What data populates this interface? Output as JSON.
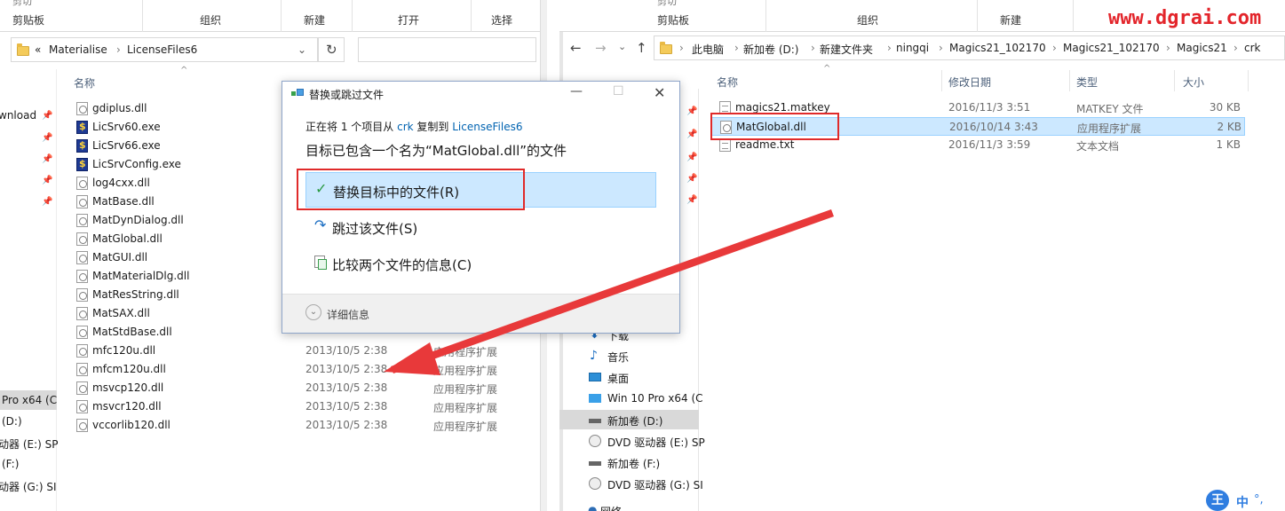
{
  "left": {
    "ribbon": {
      "cut": "剪贴板",
      "clipboard": "剪贴板",
      "organize": "组织",
      "new": "新建",
      "open": "打开",
      "select": "选择"
    },
    "path": [
      "Materialise",
      "LicenseFiles6"
    ],
    "back": "«",
    "columns": {
      "name": "名称"
    },
    "files": [
      {
        "name": "gdiplus.dll",
        "icon": "dll"
      },
      {
        "name": "LicSrv60.exe",
        "icon": "exe"
      },
      {
        "name": "LicSrv66.exe",
        "icon": "exe"
      },
      {
        "name": "LicSrvConfig.exe",
        "icon": "exe"
      },
      {
        "name": "log4cxx.dll",
        "icon": "dll"
      },
      {
        "name": "MatBase.dll",
        "icon": "dll"
      },
      {
        "name": "MatDynDialog.dll",
        "icon": "dll"
      },
      {
        "name": "MatGlobal.dll",
        "icon": "dll"
      },
      {
        "name": "MatGUI.dll",
        "icon": "dll"
      },
      {
        "name": "MatMaterialDlg.dll",
        "icon": "dll"
      },
      {
        "name": "MatResString.dll",
        "icon": "dll"
      },
      {
        "name": "MatSAX.dll",
        "icon": "dll"
      },
      {
        "name": "MatStdBase.dll",
        "icon": "dll"
      },
      {
        "name": "mfc120u.dll",
        "icon": "dll",
        "date": "2013/10/5 2:38",
        "type": "应用程序扩展"
      },
      {
        "name": "mfcm120u.dll",
        "icon": "dll",
        "date": "2013/10/5 2:38",
        "type": "应用程序扩展"
      },
      {
        "name": "msvcp120.dll",
        "icon": "dll",
        "date": "2013/10/5 2:38",
        "type": "应用程序扩展"
      },
      {
        "name": "msvcr120.dll",
        "icon": "dll",
        "date": "2013/10/5 2:38",
        "type": "应用程序扩展"
      },
      {
        "name": "vccorlib120.dll",
        "icon": "dll",
        "date": "2013/10/5 2:38",
        "type": "应用程序扩展"
      }
    ],
    "nav": [
      {
        "label": "wnload"
      },
      {
        "label": "Pro x64 (C"
      },
      {
        "label": "(D:)"
      },
      {
        "label": "动器 (E:) SP"
      },
      {
        "label": "(F:)"
      },
      {
        "label": "动器 (G:) SI"
      }
    ]
  },
  "right": {
    "ribbon": {
      "clipboard": "剪贴板",
      "organize": "组织",
      "new": "新建"
    },
    "watermark": "www.dgrai.com",
    "path": [
      "此电脑",
      "新加卷 (D:)",
      "新建文件夹",
      "ningqi",
      "Magics21_102170",
      "Magics21_102170",
      "Magics21",
      "crk"
    ],
    "columns": {
      "name": "名称",
      "date": "修改日期",
      "type": "类型",
      "size": "大小"
    },
    "files": [
      {
        "name": "magics21.matkey",
        "date": "2016/11/3 3:51",
        "type": "MATKEY 文件",
        "size": "30 KB",
        "icon": "txt"
      },
      {
        "name": "MatGlobal.dll",
        "date": "2016/10/14 3:43",
        "type": "应用程序扩展",
        "size": "2 KB",
        "icon": "dll"
      },
      {
        "name": "readme.txt",
        "date": "2016/11/3 3:59",
        "type": "文本文档",
        "size": "1 KB",
        "icon": "txt"
      }
    ],
    "nav": [
      {
        "label": "下载"
      },
      {
        "label": "音乐"
      },
      {
        "label": "桌面"
      },
      {
        "label": "Win 10 Pro x64 (C"
      },
      {
        "label": "新加卷 (D:)"
      },
      {
        "label": "DVD 驱动器 (E:) SP"
      },
      {
        "label": "新加卷 (F:)"
      },
      {
        "label": "DVD 驱动器 (G:) SI"
      },
      {
        "label": "网络"
      }
    ],
    "ime": {
      "mode": "中",
      "punct": "°,"
    }
  },
  "dialog": {
    "title": "替换或跳过文件",
    "progress_prefix": "正在将 1 个项目从",
    "source": "crk",
    "progress_mid": "复制到",
    "dest": "LicenseFiles6",
    "heading": "目标已包含一个名为“MatGlobal.dll”的文件",
    "replace": "替换目标中的文件(R)",
    "skip": "跳过该文件(S)",
    "compare": "比较两个文件的信息(C)",
    "details": "详细信息"
  },
  "colors": {
    "accent": "#cce8ff",
    "link": "#0063b1",
    "highlight": "#e02a2a"
  }
}
